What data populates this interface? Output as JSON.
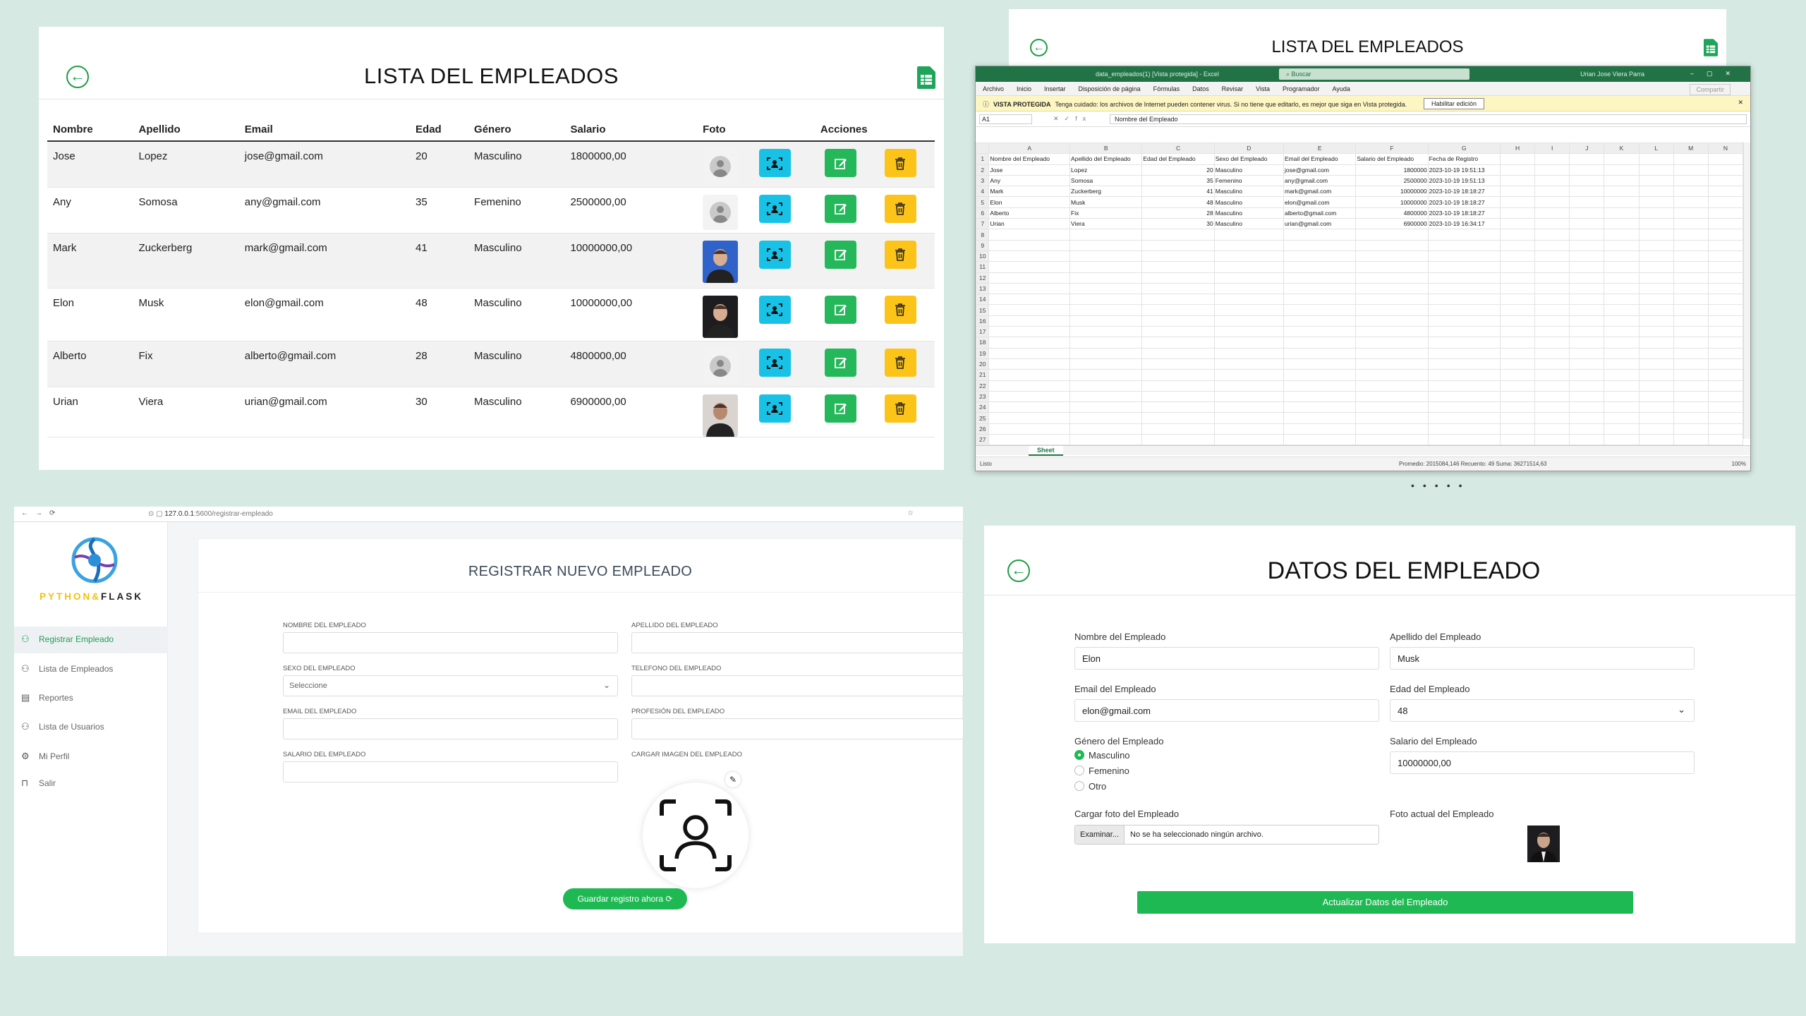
{
  "table_panel": {
    "title": "LISTA DEL EMPLEADOS",
    "headers": [
      "Nombre",
      "Apellido",
      "Email",
      "Edad",
      "Género",
      "Salario",
      "Foto",
      "Acciones"
    ],
    "rows": [
      {
        "nombre": "Jose",
        "apellido": "Lopez",
        "email": "jose@gmail.com",
        "edad": "20",
        "genero": "Masculino",
        "salario": "1800000,00",
        "foto": "default-avatar"
      },
      {
        "nombre": "Any",
        "apellido": "Somosa",
        "email": "any@gmail.com",
        "edad": "35",
        "genero": "Femenino",
        "salario": "2500000,00",
        "foto": "default-avatar"
      },
      {
        "nombre": "Mark",
        "apellido": "Zuckerberg",
        "email": "mark@gmail.com",
        "edad": "41",
        "genero": "Masculino",
        "salario": "10000000,00",
        "foto": "photo-blue"
      },
      {
        "nombre": "Elon",
        "apellido": "Musk",
        "email": "elon@gmail.com",
        "edad": "48",
        "genero": "Masculino",
        "salario": "10000000,00",
        "foto": "photo-dark"
      },
      {
        "nombre": "Alberto",
        "apellido": "Fix",
        "email": "alberto@gmail.com",
        "edad": "28",
        "genero": "Masculino",
        "salario": "4800000,00",
        "foto": "default-avatar"
      },
      {
        "nombre": "Urian",
        "apellido": "Viera",
        "email": "urian@gmail.com",
        "edad": "30",
        "genero": "Masculino",
        "salario": "6900000,00",
        "foto": "photo-light"
      }
    ],
    "action_icons": [
      "view-profile-icon",
      "edit-icon",
      "delete-icon"
    ],
    "colors": {
      "cyan": "#18c2e6",
      "green": "#24b85a",
      "yellow": "#fcc419"
    }
  },
  "excel_panel": {
    "header_title": "LISTA DEL EMPLEADOS",
    "window_title": "data_empleados(1) [Vista protegida] - Excel",
    "search": "Buscar",
    "user": "Urian Jose Viera Parra",
    "menu": [
      "Archivo",
      "Inicio",
      "Insertar",
      "Disposición de página",
      "Fórmulas",
      "Datos",
      "Revisar",
      "Vista",
      "Programador",
      "Ayuda"
    ],
    "share": "Compartir",
    "warning_label": "VISTA PROTEGIDA",
    "warning_text": "Tenga cuidado: los archivos de Internet pueden contener virus. Si no tiene que editarlo, es mejor que siga en Vista protegida.",
    "enable_button": "Habilitar edición",
    "name_box": "A1",
    "formula": "Nombre del Empleado",
    "columns": [
      "A",
      "B",
      "C",
      "D",
      "E",
      "F",
      "G",
      "H",
      "I",
      "J",
      "K",
      "L",
      "M",
      "N"
    ],
    "header_row": [
      "Nombre del Empleado",
      "Apellido del Empleado",
      "Edad del Empleado",
      "Sexo del Empleado",
      "Email del Empleado",
      "Salario del Empleado",
      "Fecha de Registro"
    ],
    "rows": [
      [
        "Jose",
        "Lopez",
        "20",
        "Masculino",
        "jose@gmail.com",
        "1800000",
        "2023-10-19 19:51:13"
      ],
      [
        "Any",
        "Somosa",
        "35",
        "Femenino",
        "any@gmail.com",
        "2500000",
        "2023-10-19 19:51:13"
      ],
      [
        "Mark",
        "Zuckerberg",
        "41",
        "Masculino",
        "mark@gmail.com",
        "10000000",
        "2023-10-19 18:18:27"
      ],
      [
        "Elon",
        "Musk",
        "48",
        "Masculino",
        "elon@gmail.com",
        "10000000",
        "2023-10-19 18:18:27"
      ],
      [
        "Alberto",
        "Fix",
        "28",
        "Masculino",
        "alberto@gmail.com",
        "4800000",
        "2023-10-19 18:18:27"
      ],
      [
        "Urian",
        "Viera",
        "30",
        "Masculino",
        "urian@gmail.com",
        "6900000",
        "2023-10-19 16:34:17"
      ]
    ],
    "sheet_tab": "Sheet",
    "status_left": "Listo",
    "status_stats": "Promedio: 2015084,146     Recuento: 49     Suma: 36271514,63",
    "zoom": "100%"
  },
  "register_panel": {
    "url_host": "127.0.0.1",
    "url_path": ":5600/registrar-empleado",
    "brand_python": "PYTHON",
    "brand_amp": "&",
    "brand_flask": "FLASK",
    "sidebar": [
      {
        "label": "Registrar Empleado",
        "icon": "user-add-icon",
        "active": true
      },
      {
        "label": "Lista de Empleados",
        "icon": "users-icon",
        "active": false
      },
      {
        "label": "Reportes",
        "icon": "report-icon",
        "active": false
      },
      {
        "label": "Lista de Usuarios",
        "icon": "users-list-icon",
        "active": false
      },
      {
        "label": "Mi Perfil",
        "icon": "profile-icon",
        "active": false
      },
      {
        "label": "Salir",
        "icon": "lock-icon",
        "active": false
      }
    ],
    "title": "REGISTRAR NUEVO EMPLEADO",
    "fields": {
      "nombre": "NOMBRE DEL EMPLEADO",
      "apellido": "APELLIDO DEL EMPLEADO",
      "sexo": "SEXO DEL EMPLEADO",
      "sexo_value": "Seleccione",
      "telefono": "TELEFONO DEL EMPLEADO",
      "email": "EMAIL DEL EMPLEADO",
      "profesion": "PROFESIÓN DEL EMPLEADO",
      "salario": "SALARIO DEL EMPLEADO",
      "imagen": "CARGAR IMAGEN DEL EMPLEADO"
    },
    "save_button": "Guardar registro ahora"
  },
  "data_panel": {
    "title": "DATOS DEL EMPLEADO",
    "nombre_label": "Nombre del Empleado",
    "nombre_value": "Elon",
    "apellido_label": "Apellido del Empleado",
    "apellido_value": "Musk",
    "email_label": "Email del Empleado",
    "email_value": "elon@gmail.com",
    "edad_label": "Edad del Empleado",
    "edad_value": "48",
    "genero_label": "Género del Empleado",
    "genero_options": [
      "Masculino",
      "Femenino",
      "Otro"
    ],
    "genero_selected": "Masculino",
    "salario_label": "Salario del Empleado",
    "salario_value": "10000000,00",
    "foto_label": "Cargar foto del Empleado",
    "file_button": "Examinar...",
    "file_text": "No se ha seleccionado ningún archivo.",
    "foto_actual_label": "Foto actual del Empleado",
    "update_button": "Actualizar Datos del Empleado"
  }
}
